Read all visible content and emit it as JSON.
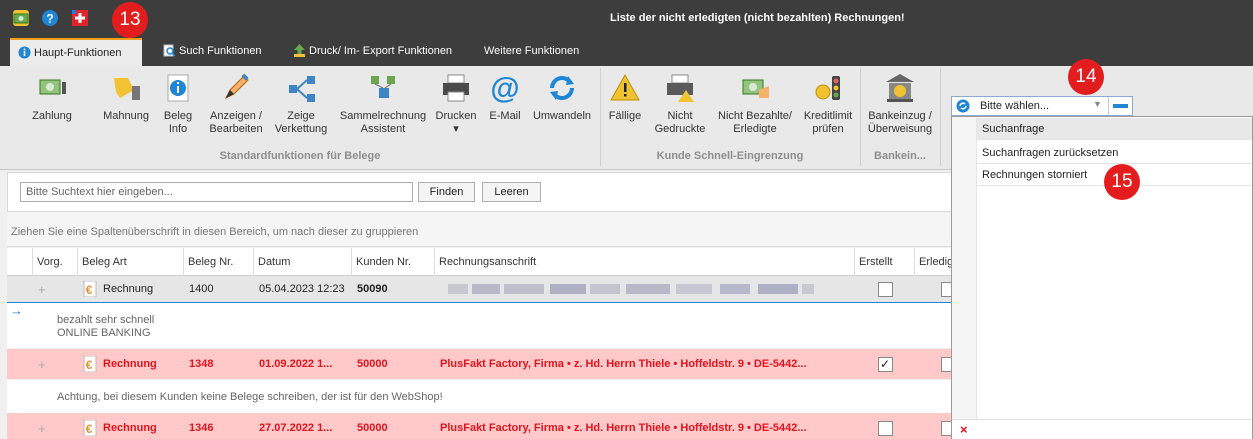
{
  "window": {
    "title": "Liste der nicht erledigten (nicht bezahlten) Rechnungen!"
  },
  "quick_access": [
    "money-icon",
    "help-icon",
    "swiss-flag-icon"
  ],
  "badges": {
    "b13": "13",
    "b14": "14",
    "b15": "15"
  },
  "tabs": [
    {
      "label": "Haupt-Funktionen"
    },
    {
      "label": "Such Funktionen"
    },
    {
      "label": "Druck/ Im- Export Funktionen"
    },
    {
      "label": "Weitere Funktionen"
    }
  ],
  "ribbon": {
    "buttons": [
      {
        "label": "Zahlung"
      },
      {
        "label": "Mahnung"
      },
      {
        "label1": "Beleg",
        "label2": "Info"
      },
      {
        "label1": "Anzeigen /",
        "label2": "Bearbeiten"
      },
      {
        "label1": "Zeige",
        "label2": "Verkettung"
      },
      {
        "label1": "Sammelrechnung",
        "label2": "Assistent"
      },
      {
        "label": "Drucken"
      },
      {
        "label": "E-Mail"
      },
      {
        "label": "Umwandeln"
      },
      {
        "label": "Fällige"
      },
      {
        "label1": "Nicht",
        "label2": "Gedruckte"
      },
      {
        "label1": "Nicht Bezahlte/",
        "label2": "Erledigte"
      },
      {
        "label1": "Kreditlimit",
        "label2": "prüfen"
      },
      {
        "label1": "Bankeinzug /",
        "label2": "Überweisung"
      }
    ],
    "groups": {
      "standard": "Standardfunktionen für Belege",
      "kunde": "Kunde Schnell-Eingrenzung",
      "bank": "Bankein..."
    }
  },
  "search": {
    "placeholder": "Bitte Suchtext hier eingeben...",
    "find_label": "Finden",
    "clear_label": "Leeren"
  },
  "grid": {
    "group_hint": "Ziehen Sie eine Spaltenüberschrift in diesen Bereich, um nach dieser zu gruppieren",
    "columns": [
      "Vorg.",
      "Beleg Art",
      "Beleg Nr.",
      "Datum",
      "Kunden Nr.",
      "Rechnungsanschrift",
      "Erstellt",
      "Erledig"
    ],
    "rows": [
      {
        "art": "Rechnung",
        "nr": "1400",
        "datum": "05.04.2023 12:23",
        "kunde": "50090",
        "anschrift": "",
        "erstellt": false,
        "note1": "bezahlt sehr schnell",
        "note2": "ONLINE BANKING"
      },
      {
        "art": "Rechnung",
        "nr": "1348",
        "datum": "01.09.2022 1...",
        "kunde": "50000",
        "anschrift": "PlusFakt Factory, Firma • z. Hd. Herrn Thiele • Hoffeldstr. 9 • DE-5442...",
        "erstellt": true,
        "note1": "Achtung, bei diesem Kunden keine Belege schreiben, der ist für den WebShop!"
      },
      {
        "art": "Rechnung",
        "nr": "1346",
        "datum": "27.07.2022 1...",
        "kunde": "50000",
        "anschrift": "PlusFakt Factory, Firma • z. Hd. Herrn Thiele • Hoffeldstr. 9 • DE-5442...",
        "erstellt": false
      }
    ]
  },
  "dropdown": {
    "value": "Bitte wählen...",
    "items": [
      "Suchanfrage",
      "Suchanfragen zurücksetzen",
      "Rechnungen storniert"
    ],
    "close_glyph": "×"
  },
  "colors": {
    "accent": "#f29d1b",
    "highlight_row": "#ffc9c9",
    "red_text": "#e0141e",
    "badge": "#e31d1d"
  }
}
